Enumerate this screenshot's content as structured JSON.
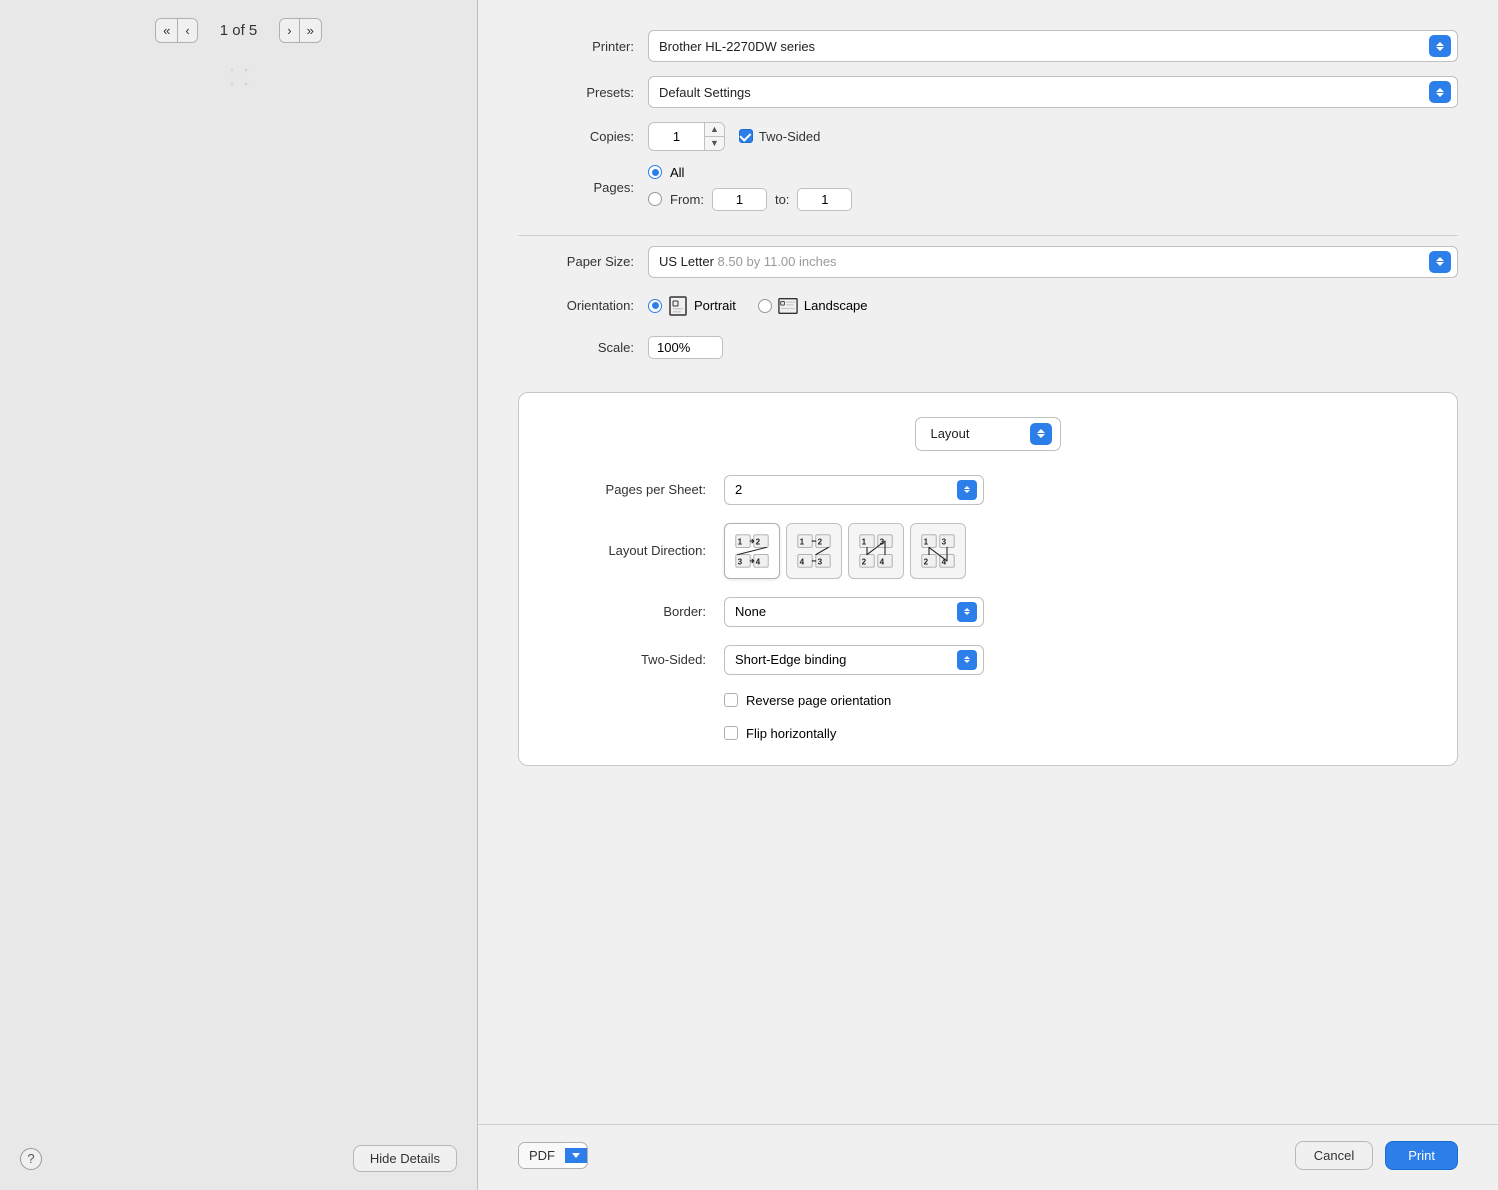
{
  "leftPanel": {
    "pageIndicator": "1 of 5",
    "helpLabel": "?",
    "hideDetailsLabel": "Hide Details",
    "navFirst": "«",
    "navPrev": "‹",
    "navNext": "›",
    "navLast": "»"
  },
  "printer": {
    "label": "Printer:",
    "value": "Brother HL-2270DW series"
  },
  "presets": {
    "label": "Presets:",
    "value": "Default Settings"
  },
  "copies": {
    "label": "Copies:",
    "value": "1",
    "twoSidedLabel": "Two-Sided"
  },
  "pages": {
    "label": "Pages:",
    "allLabel": "All",
    "fromLabel": "From:",
    "toLabel": "to:",
    "fromValue": "1",
    "toValue": "1"
  },
  "paperSize": {
    "label": "Paper Size:",
    "value": "US Letter",
    "subValue": "8.50 by 11.00 inches"
  },
  "orientation": {
    "label": "Orientation:",
    "portraitLabel": "Portrait",
    "landscapeLabel": "Landscape"
  },
  "scale": {
    "label": "Scale:",
    "value": "100%"
  },
  "layout": {
    "panelLabel": "Layout",
    "pagesPerSheet": {
      "label": "Pages per Sheet:",
      "value": "2"
    },
    "layoutDirection": {
      "label": "Layout Direction:"
    },
    "border": {
      "label": "Border:",
      "value": "None"
    },
    "twoSided": {
      "label": "Two-Sided:",
      "value": "Short-Edge binding"
    },
    "reversePageOrientation": "Reverse page orientation",
    "flipHorizontally": "Flip horizontally"
  },
  "bottomBar": {
    "pdfLabel": "PDF",
    "cancelLabel": "Cancel",
    "printLabel": "Print"
  }
}
